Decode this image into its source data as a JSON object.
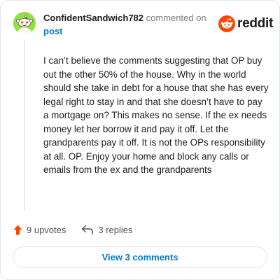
{
  "header": {
    "username": "ConfidentSandwich782",
    "action_text": "commented on",
    "post_link": "post"
  },
  "brand": {
    "logo_word": "reddit",
    "logo_icon": "reddit-alien-icon",
    "color": "#ff4500"
  },
  "comment": {
    "body": "I can’t believe the comments suggesting that OP buy out the other 50% of the house. Why in the world should she take in debt for a house that she has every legal right to stay in and that she doesn’t have to pay a mortgage on? This makes no sense. If the ex needs money let her borrow it and pay it off. Let the grandparents pay it off. It is not the OPs responsibility at all. OP. Enjoy your home and block any calls or emails from the ex and the grandparents"
  },
  "actions": {
    "upvotes": "9 upvotes",
    "upvote_icon": "upvote-arrow-icon",
    "replies": "3 replies",
    "reply_icon": "reply-arrow-icon"
  },
  "footer": {
    "view_comments": "View 3 comments"
  },
  "colors": {
    "avatar": "#94e044",
    "link": "#0079d3",
    "upvote": "#ff4500"
  }
}
